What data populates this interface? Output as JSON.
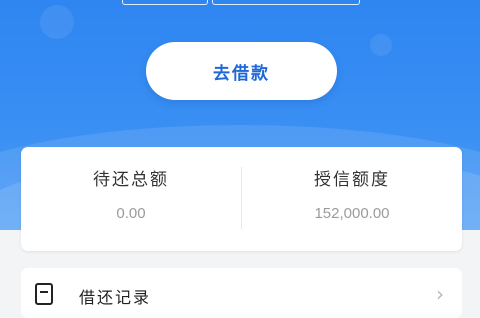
{
  "header": {
    "borrow_button_label": "去借款"
  },
  "summary": {
    "left_label": "待还总额",
    "left_value": "0.00",
    "right_label": "授信额度",
    "right_value": "152,000.00"
  },
  "record": {
    "label": "借还记录"
  },
  "colors": {
    "primary_blue": "#2f86f1",
    "button_text": "#1e67d8",
    "value_gray": "#9b9b9b"
  },
  "icons": {
    "record": "document-icon",
    "chevron": "chevron-right-icon"
  }
}
